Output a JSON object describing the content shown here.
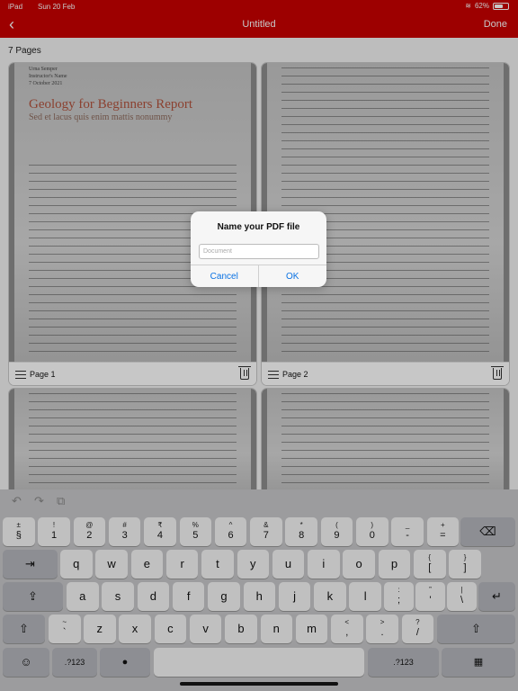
{
  "status": {
    "time": "iPad",
    "date": "Sun 20 Feb",
    "battery": "62%",
    "battery_level": 0.62
  },
  "nav": {
    "back_icon": "chevron-left",
    "title": "Untitled",
    "done": "Done"
  },
  "main": {
    "page_count": "7 Pages",
    "pages": [
      {
        "label": "Page 1",
        "doc_meta": [
          "Urna Semper",
          "Instructor's Name",
          "7 October 2021"
        ],
        "doc_title": "Geology for Beginners Report",
        "doc_subtitle": "Sed et lacus quis enim mattis nonummy"
      },
      {
        "label": "Page 2"
      },
      {
        "label": ""
      },
      {
        "label": ""
      }
    ]
  },
  "dialog": {
    "title": "Name your PDF file",
    "placeholder": "Document",
    "cancel": "Cancel",
    "ok": "OK"
  },
  "keyboard": {
    "toolbar": {
      "undo": "↶",
      "redo": "↷",
      "paste": "⧉"
    },
    "row1": [
      {
        "top": "±",
        "bottom": "§"
      },
      {
        "top": "!",
        "bottom": "1"
      },
      {
        "top": "@",
        "bottom": "2"
      },
      {
        "top": "#",
        "bottom": "3"
      },
      {
        "top": "₹",
        "bottom": "4"
      },
      {
        "top": "%",
        "bottom": "5"
      },
      {
        "top": "^",
        "bottom": "6"
      },
      {
        "top": "&",
        "bottom": "7"
      },
      {
        "top": "*",
        "bottom": "8"
      },
      {
        "top": "(",
        "bottom": "9"
      },
      {
        "top": ")",
        "bottom": "0"
      },
      {
        "top": "_",
        "bottom": "-"
      },
      {
        "top": "+",
        "bottom": "="
      }
    ],
    "row2": [
      "q",
      "w",
      "e",
      "r",
      "t",
      "y",
      "u",
      "i",
      "o",
      "p"
    ],
    "row2_extra": [
      {
        "top": "{",
        "bottom": "["
      },
      {
        "top": "}",
        "bottom": "]"
      }
    ],
    "row3": [
      "a",
      "s",
      "d",
      "f",
      "g",
      "h",
      "j",
      "k",
      "l"
    ],
    "row3_extra": [
      {
        "top": ":",
        "bottom": ";"
      },
      {
        "top": "”",
        "bottom": "'"
      },
      {
        "top": "|",
        "bottom": "\\"
      }
    ],
    "row4_left": [
      {
        "top": "~",
        "bottom": "`"
      }
    ],
    "row4": [
      "z",
      "x",
      "c",
      "v",
      "b",
      "n",
      "m"
    ],
    "row4_extra": [
      {
        "top": "<",
        "bottom": ","
      },
      {
        "top": ">",
        "bottom": "."
      },
      {
        "top": "?",
        "bottom": "/"
      }
    ],
    "num_label": ".?123",
    "icons": {
      "delete": "⌫",
      "tab": "⇥",
      "caps": "⇪",
      "return": "↵",
      "shift": "⇧",
      "emoji": "☺",
      "mic": "🎙",
      "hide": "⌨"
    }
  }
}
